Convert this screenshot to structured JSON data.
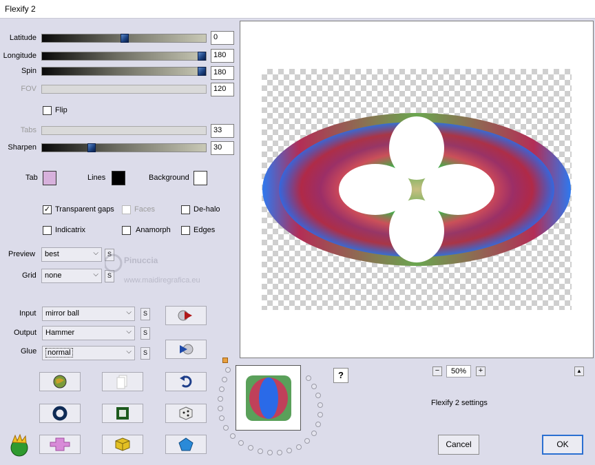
{
  "window": {
    "title": "Flexify 2"
  },
  "sliders": {
    "latitude": {
      "label": "Latitude",
      "value": "0"
    },
    "longitude": {
      "label": "Longitude",
      "value": "180"
    },
    "spin": {
      "label": "Spin",
      "value": "180"
    },
    "fov": {
      "label": "FOV",
      "value": "120"
    },
    "tabs": {
      "label": "Tabs",
      "value": "33"
    },
    "sharpen": {
      "label": "Sharpen",
      "value": "30"
    }
  },
  "flip": {
    "label": "Flip",
    "checked": false
  },
  "colors": {
    "tab": {
      "label": "Tab",
      "color": "#d7b1dc"
    },
    "lines": {
      "label": "Lines",
      "color": "#000000"
    },
    "background": {
      "label": "Background",
      "color": "#ffffff"
    }
  },
  "options": {
    "transparent_gaps": {
      "label": "Transparent gaps",
      "checked": true
    },
    "faces": {
      "label": "Faces",
      "checked": false
    },
    "de_halo": {
      "label": "De-halo",
      "checked": false
    },
    "indicatrix": {
      "label": "Indicatrix",
      "checked": false
    },
    "anamorph": {
      "label": "Anamorph",
      "checked": false
    },
    "edges": {
      "label": "Edges",
      "checked": false
    }
  },
  "preview_select": {
    "label": "Preview",
    "value": "best",
    "s": "S"
  },
  "grid_select": {
    "label": "Grid",
    "value": "none",
    "s": "S"
  },
  "input_select": {
    "label": "Input",
    "value": "mirror ball",
    "s": "S"
  },
  "output_select": {
    "label": "Output",
    "value": "Hammer",
    "s": "S"
  },
  "glue_select": {
    "label": "Glue",
    "value": "normal",
    "s": "S"
  },
  "watermark": {
    "name": "Pinuccia",
    "url": "www.maidiregrafica.eu"
  },
  "zoom": {
    "minus": "−",
    "value": "50%",
    "plus": "+",
    "up": "▲"
  },
  "help": "?",
  "settings_label": "Flexify 2 settings",
  "buttons": {
    "cancel": "Cancel",
    "ok": "OK"
  }
}
